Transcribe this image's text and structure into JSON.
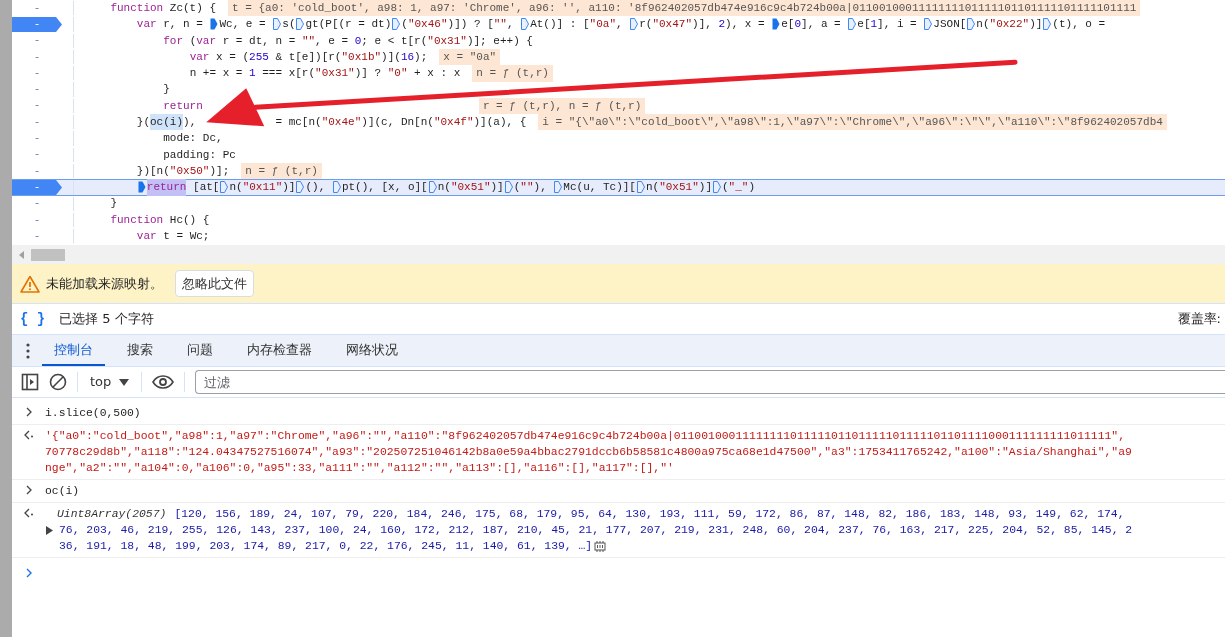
{
  "editor": {
    "lines": [
      {
        "gutter": "-",
        "breakpoint": false,
        "current": false,
        "segments": [
          {
            "kind": "text",
            "text": "    function Zc(t) {"
          }
        ],
        "hint": "t = {a0: 'cold_boot', a98: 1, a97: 'Chrome', a96: '', a110: '8f962402057db474e916c9c4b724b00a|0110010001111111101111101101111101111101111"
      },
      {
        "gutter": "-",
        "breakpoint": true,
        "current": false,
        "segments": [
          {
            "kind": "text",
            "text": "        var r, n = "
          },
          {
            "kind": "marker",
            "active": true
          },
          {
            "kind": "text",
            "text": "Wc, e = "
          },
          {
            "kind": "marker",
            "active": false
          },
          {
            "kind": "text",
            "text": "s("
          },
          {
            "kind": "marker",
            "active": false
          },
          {
            "kind": "text",
            "text": "gt(P[(r = dt)"
          },
          {
            "kind": "marker",
            "active": false
          },
          {
            "kind": "text",
            "text": "(\"0x46\")]) ? [\"\", "
          },
          {
            "kind": "marker",
            "active": false
          },
          {
            "kind": "text",
            "text": "At()] : [\"0a\", "
          },
          {
            "kind": "marker",
            "active": false
          },
          {
            "kind": "text",
            "text": "r(\"0x47\")], 2), x = "
          },
          {
            "kind": "marker",
            "active": true
          },
          {
            "kind": "text",
            "text": "e[0], a = "
          },
          {
            "kind": "marker",
            "active": false
          },
          {
            "kind": "text",
            "text": "e[1], i = "
          },
          {
            "kind": "marker",
            "active": false
          },
          {
            "kind": "text",
            "text": "JSON["
          },
          {
            "kind": "marker",
            "active": false
          },
          {
            "kind": "text",
            "text": "n(\"0x22\")]"
          },
          {
            "kind": "marker",
            "active": false
          },
          {
            "kind": "text",
            "text": "(t), o ="
          }
        ]
      },
      {
        "gutter": "-",
        "breakpoint": false,
        "current": false,
        "segments": [
          {
            "kind": "text",
            "text": "            for (var r = dt, n = \"\", e = 0; e < t[r(\"0x31\")]; e++) {"
          }
        ]
      },
      {
        "gutter": "-",
        "breakpoint": false,
        "current": false,
        "segments": [
          {
            "kind": "text",
            "text": "                var x = (255 & t[e])[r(\"0x1b\")](16);"
          }
        ],
        "hint": "x = \"0a\""
      },
      {
        "gutter": "-",
        "breakpoint": false,
        "current": false,
        "segments": [
          {
            "kind": "text",
            "text": "                n += x = 1 === x[r(\"0x31\")] ? \"0\" + x : x"
          }
        ],
        "hint": "n = ƒ (t,r)"
      },
      {
        "gutter": "-",
        "breakpoint": false,
        "current": false,
        "segments": [
          {
            "kind": "text",
            "text": "            }"
          }
        ]
      },
      {
        "gutter": "-",
        "breakpoint": false,
        "current": false,
        "segments": [
          {
            "kind": "text",
            "text": "            return                                        "
          }
        ],
        "hint": "r = ƒ (t,r), n = ƒ (t,r)"
      },
      {
        "gutter": "-",
        "breakpoint": false,
        "current": false,
        "segments": [
          {
            "kind": "text",
            "text": "        }("
          },
          {
            "kind": "selected",
            "text": "oc(i)"
          },
          {
            "kind": "text",
            "text": "),"
          },
          {
            "kind": "text",
            "text": "            = mc[n(\"0x4e\")](c, Dn[n(\"0x4f\")](a), {"
          }
        ],
        "hint": "i = \"{\\\"a0\\\":\\\"cold_boot\\\",\\\"a98\\\":1,\\\"a97\\\":\\\"Chrome\\\",\\\"a96\\\":\\\"\\\",\\\"a110\\\":\\\"8f962402057db4"
      },
      {
        "gutter": "-",
        "breakpoint": false,
        "current": false,
        "segments": [
          {
            "kind": "text",
            "text": "            mode: Dc,"
          }
        ]
      },
      {
        "gutter": "-",
        "breakpoint": false,
        "current": false,
        "segments": [
          {
            "kind": "text",
            "text": "            padding: Pc"
          }
        ]
      },
      {
        "gutter": "-",
        "breakpoint": false,
        "current": false,
        "segments": [
          {
            "kind": "text",
            "text": "        })[n(\"0x50\")];"
          }
        ],
        "hint": "n = ƒ (t,r)"
      },
      {
        "gutter": "-",
        "breakpoint": true,
        "current": true,
        "segments": [
          {
            "kind": "marker",
            "active": true
          },
          {
            "kind": "selected",
            "text": "return"
          },
          {
            "kind": "text",
            "text": " [at["
          },
          {
            "kind": "marker",
            "active": false
          },
          {
            "kind": "text",
            "text": "n(\"0x11\")]"
          },
          {
            "kind": "marker",
            "active": false
          },
          {
            "kind": "text",
            "text": "(), "
          },
          {
            "kind": "marker",
            "active": false
          },
          {
            "kind": "text",
            "text": "pt(), [x, o]["
          },
          {
            "kind": "marker",
            "active": false
          },
          {
            "kind": "text",
            "text": "n(\"0x51\")]"
          },
          {
            "kind": "marker",
            "active": false
          },
          {
            "kind": "text",
            "text": "(\"\"), "
          },
          {
            "kind": "marker",
            "active": false
          },
          {
            "kind": "text",
            "text": "Mc(u, Tc)]["
          },
          {
            "kind": "marker",
            "active": false
          },
          {
            "kind": "text",
            "text": "n(\"0x51\")]"
          },
          {
            "kind": "marker",
            "active": false
          },
          {
            "kind": "text",
            "text": "(\"_\")"
          }
        ]
      },
      {
        "gutter": "-",
        "breakpoint": false,
        "current": false,
        "segments": [
          {
            "kind": "text",
            "text": "    }"
          }
        ]
      },
      {
        "gutter": "-",
        "breakpoint": false,
        "current": false,
        "segments": [
          {
            "kind": "text",
            "text": "    function Hc() {"
          }
        ]
      },
      {
        "gutter": "-",
        "breakpoint": false,
        "current": false,
        "segments": [
          {
            "kind": "text",
            "text": "        var t = Wc;"
          }
        ]
      }
    ]
  },
  "warning": {
    "message": "未能加载来源映射。",
    "button": "忽略此文件"
  },
  "status": {
    "icon_text": "{ }",
    "selection": "已选择 5 个字符",
    "coverage": "覆盖率:"
  },
  "tabs": [
    {
      "label": "控制台",
      "selected": true
    },
    {
      "label": "搜索",
      "selected": false
    },
    {
      "label": "问题",
      "selected": false
    },
    {
      "label": "内存检查器",
      "selected": false
    },
    {
      "label": "网络状况",
      "selected": false
    }
  ],
  "toolbar": {
    "context": "top",
    "filter": {
      "placeholder": "过滤"
    }
  },
  "console": [
    {
      "kind": "input",
      "lines": [
        "i.slice(0,500)"
      ]
    },
    {
      "kind": "string",
      "lines": [
        "'{\"a0\":\"cold_boot\",\"a98\":1,\"a97\":\"Chrome\",\"a96\":\"\",\"a110\":\"8f962402057db474e916c9c4b724b00a|0110010001111111101111101101111101111101101111000111111111011111\",",
        "70778c29d8b\",\"a118\":\"124.04347527516074\",\"a93\":\"202507251046142b8a0e59a4bbac2791dccb6b58581c4800a975ca68e1d47500\",\"a3\":1753411765242,\"a100\":\"Asia/Shanghai\",\"a9",
        "nge\",\"a2\":\"\",\"a104\":0,\"a106\":0,\"a95\":33,\"a111\":\"\",\"a112\":\"\",\"a113\":[],\"a116\":[],\"a117\":[],\"'"
      ]
    },
    {
      "kind": "input",
      "lines": [
        "oc(i)"
      ]
    },
    {
      "kind": "array",
      "type_label": "Uint8Array(2057)",
      "expanded": false,
      "lines": [
        "[120, 156, 189, 24, 107, 79, 220, 184, 246, 175, 68, 179, 95, 64, 130, 193, 111, 59, 172, 86, 87, 148, 82, 186, 183, 148, 93, 149, 62, 174,",
        "76, 203, 46, 219, 255, 126, 143, 237, 100, 24, 160, 172, 212, 187, 210, 45, 21, 177, 207, 219, 231, 248, 60, 204, 237, 76, 163, 217, 225, 204, 52, 85, 145, 2",
        "36, 191, 18, 48, 199, 203, 174, 89, 217, 0, 22, 176, 245, 11, 140, 61, 139, …]"
      ]
    }
  ]
}
